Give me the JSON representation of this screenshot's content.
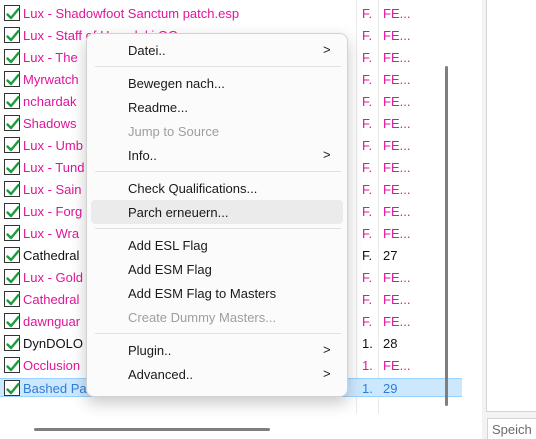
{
  "plugin_list": {
    "rows": [
      {
        "name": "Lux - Shadowfoot Sanctum patch.esp",
        "flag": "F.",
        "index": "FE...",
        "color": "pink"
      },
      {
        "name": "Lux - Staff of Hasedoki OG...",
        "flag": "F.",
        "index": "FE...",
        "color": "pink"
      },
      {
        "name": "Lux - The",
        "flag": "F.",
        "index": "FE...",
        "color": "pink"
      },
      {
        "name": "Myrwatch",
        "flag": "F.",
        "index": "FE...",
        "color": "pink"
      },
      {
        "name": "nchardak",
        "flag": "F.",
        "index": "FE...",
        "color": "pink"
      },
      {
        "name": "Shadows",
        "flag": "F.",
        "index": "FE...",
        "color": "pink"
      },
      {
        "name": "Lux - Umb",
        "flag": "F.",
        "index": "FE...",
        "color": "pink"
      },
      {
        "name": "Lux - Tund",
        "flag": "F.",
        "index": "FE...",
        "color": "pink"
      },
      {
        "name": "Lux - Sain",
        "flag": "F.",
        "index": "FE...",
        "color": "pink"
      },
      {
        "name": "Lux - Forg",
        "flag": "F.",
        "index": "FE...",
        "color": "pink"
      },
      {
        "name": "Lux - Wra",
        "flag": "F.",
        "index": "FE...",
        "color": "pink"
      },
      {
        "name": "Cathedral",
        "flag": "F.",
        "index": "27",
        "color": "dark"
      },
      {
        "name": "Lux - Gold",
        "flag": "F.",
        "index": "FE...",
        "color": "pink"
      },
      {
        "name": "Cathedral",
        "flag": "F.",
        "index": "FE...",
        "color": "pink"
      },
      {
        "name": "dawnguar",
        "flag": "F.",
        "index": "FE...",
        "color": "pink"
      },
      {
        "name": "DynDOLO",
        "flag": "1.",
        "index": "28",
        "color": "dark"
      },
      {
        "name": "Occlusion",
        "flag": "1.",
        "index": "FE...",
        "color": "pink"
      },
      {
        "name": "Bashed Patch, 0.esp",
        "flag": "1.",
        "index": "29",
        "color": "blue",
        "selected": true
      }
    ]
  },
  "context_menu": {
    "items": [
      {
        "label": "Datei..",
        "submenu": true,
        "name": "menu-item-datei"
      },
      {
        "separator": true
      },
      {
        "label": "Bewegen nach...",
        "name": "menu-item-bewegen-nach"
      },
      {
        "label": "Readme...",
        "name": "menu-item-readme"
      },
      {
        "label": "Jump to Source",
        "disabled": true,
        "name": "menu-item-jump-to-source"
      },
      {
        "label": "Info..",
        "submenu": true,
        "name": "menu-item-info"
      },
      {
        "separator": true
      },
      {
        "label": "Check Qualifications...",
        "name": "menu-item-check-qualifications"
      },
      {
        "label": "Parch erneuern...",
        "hovered": true,
        "name": "menu-item-parch-erneuern"
      },
      {
        "separator": true
      },
      {
        "label": "Add ESL Flag",
        "name": "menu-item-add-esl-flag"
      },
      {
        "label": "Add ESM Flag",
        "name": "menu-item-add-esm-flag"
      },
      {
        "label": "Add ESM Flag to Masters",
        "name": "menu-item-add-esm-flag-to-masters"
      },
      {
        "label": "Create Dummy Masters...",
        "disabled": true,
        "name": "menu-item-create-dummy-masters"
      },
      {
        "separator": true
      },
      {
        "label": "Plugin..",
        "submenu": true,
        "name": "menu-item-plugin"
      },
      {
        "label": "Advanced..",
        "submenu": true,
        "name": "menu-item-advanced"
      }
    ],
    "submenu_arrow": ">"
  },
  "right_panel": {
    "save_tab_label": "Speich"
  },
  "icons": {
    "checkbox": "checkmark-icon",
    "submenu": "chevron-right-icon"
  },
  "colors": {
    "pink_text": "#e0159b",
    "dark_text": "#111111",
    "selected_text": "#2f7dd6",
    "selected_bg": "#cce8ff",
    "check_green": "#1c9a3c"
  }
}
